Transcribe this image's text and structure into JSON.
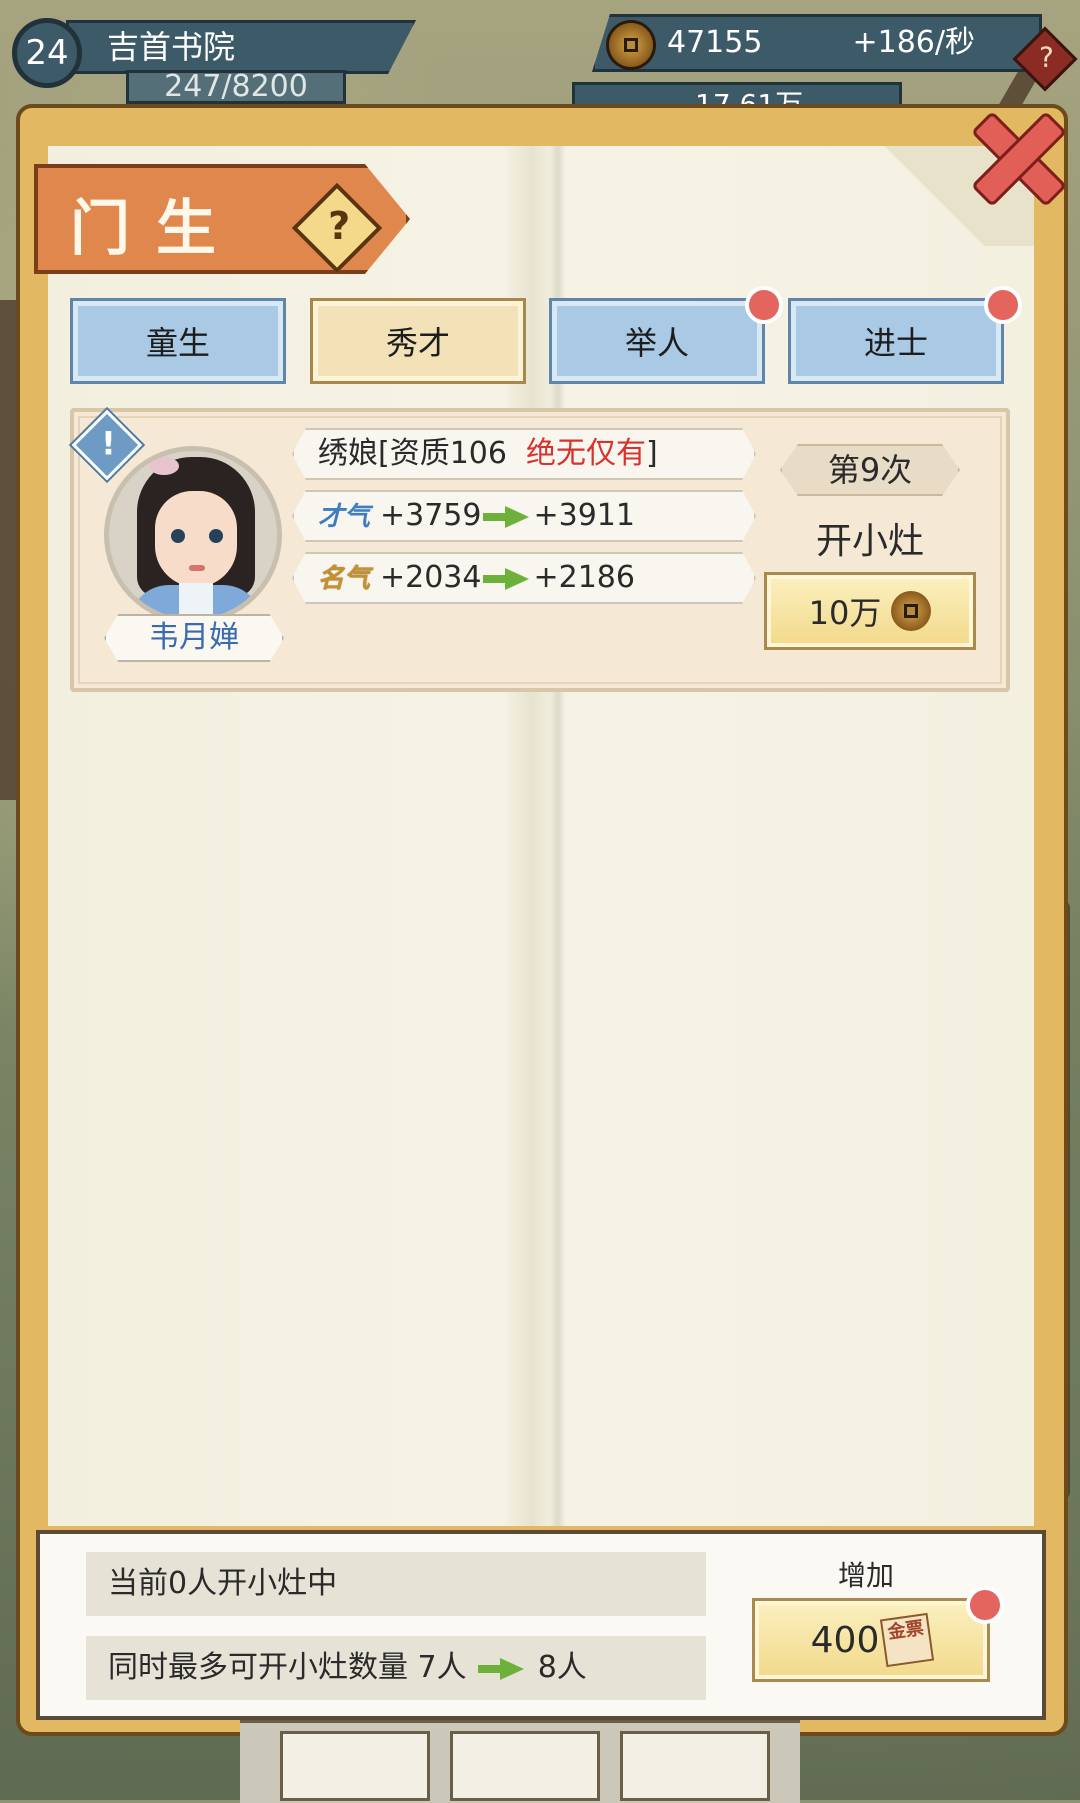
{
  "hud": {
    "level": "24",
    "academy_name": "吉首书院",
    "progress": "247/8200",
    "coins": "47155",
    "coin_rate": "+186/秒",
    "help_icon": "?",
    "talent_total_partial": "17.61万"
  },
  "panel": {
    "title": "门生",
    "help_icon": "?",
    "close_icon": "close-x"
  },
  "tabs": [
    {
      "label": "童生",
      "active": false,
      "badge": false
    },
    {
      "label": "秀才",
      "active": true,
      "badge": false
    },
    {
      "label": "举人",
      "active": false,
      "badge": true
    },
    {
      "label": "进士",
      "active": false,
      "badge": true
    }
  ],
  "student": {
    "alert_icon": "!",
    "name": "韦月婵",
    "profession": "绣娘[资质106",
    "rarity": "绝无仅有",
    "bracket_close": "]",
    "talent_label": "才气",
    "talent_from": "+3759",
    "talent_to": "+3911",
    "fame_label": "名气",
    "fame_from": "+2034",
    "fame_to": "+2186",
    "count_label": "第9次",
    "action_label": "开小灶",
    "cost": "10万"
  },
  "footer": {
    "current_status": "当前0人开小灶中",
    "max_label": "同时最多可开小灶数量 7人",
    "max_next": "8人",
    "increase_label": "增加",
    "ticket_cost": "400",
    "ticket_icon_text": "金票"
  },
  "colors": {
    "tab_blue": "#a9c9e5",
    "tab_active": "#f3e2b8",
    "title_orange": "#e0874e",
    "rarity_red": "#d8322c",
    "badge_red": "#e4655e",
    "arrow_green": "#6db03a"
  }
}
